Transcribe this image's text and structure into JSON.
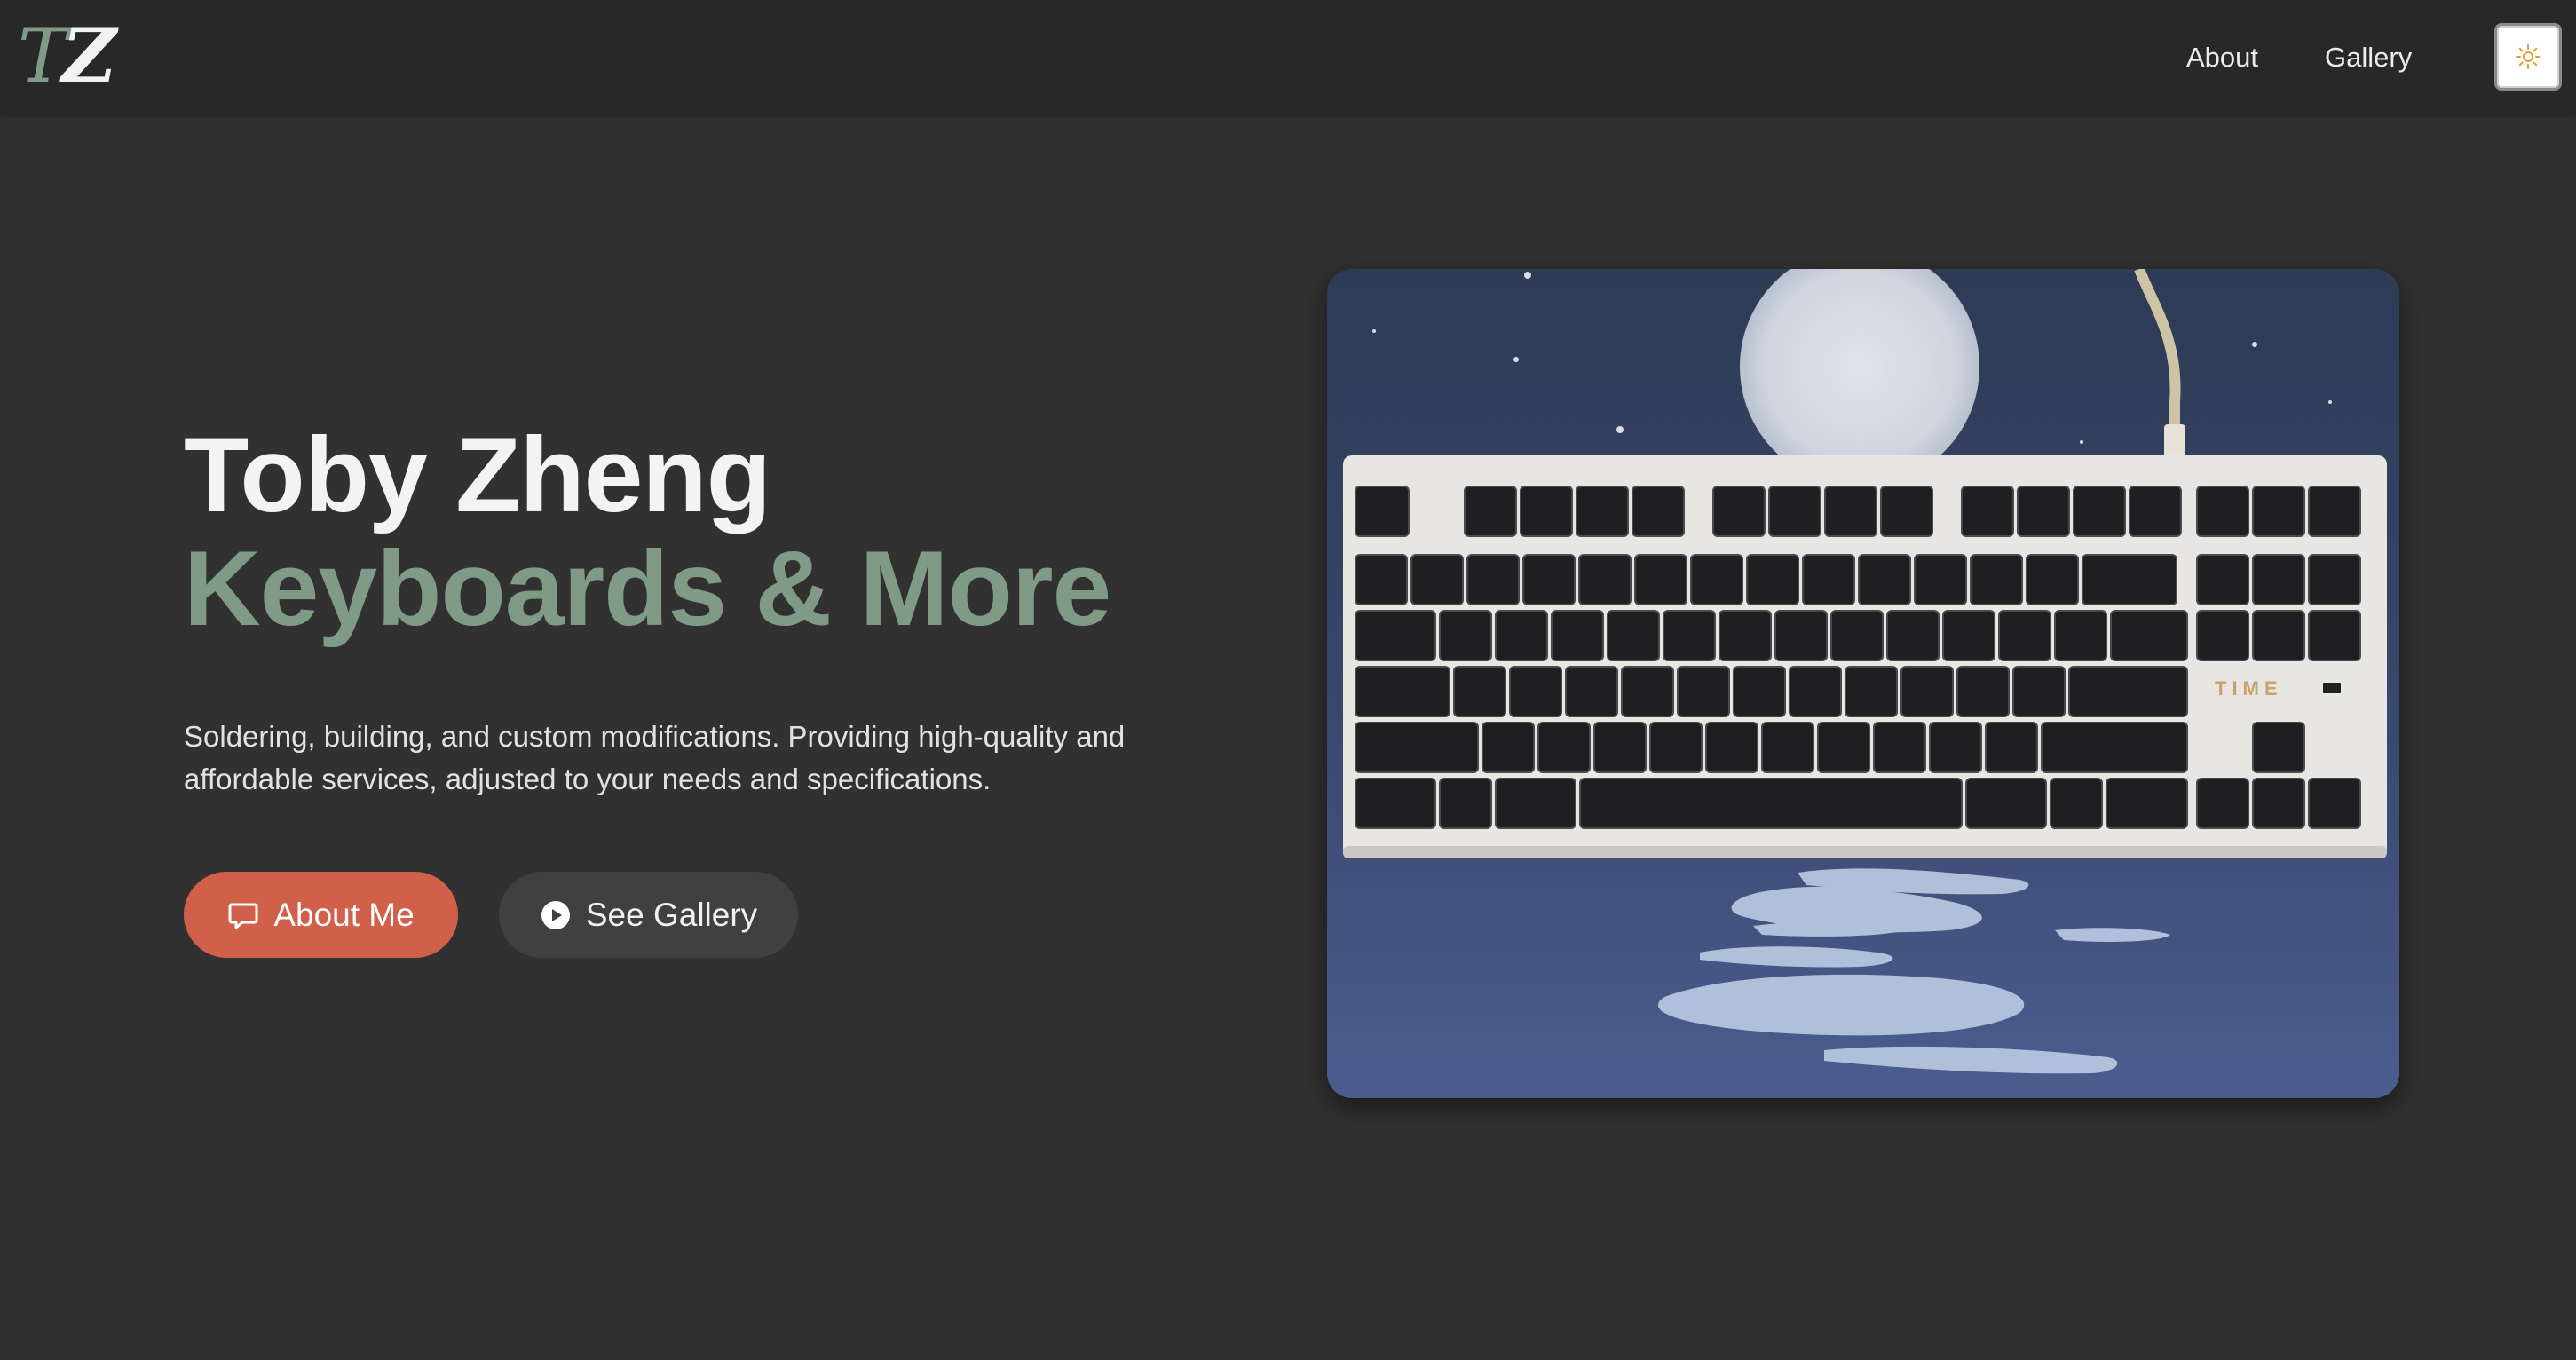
{
  "header": {
    "logo": {
      "first": "T",
      "second": "Z"
    },
    "nav": [
      {
        "label": "About"
      },
      {
        "label": "Gallery"
      }
    ],
    "theme_toggle_icon": "sun-icon"
  },
  "hero": {
    "name": "Toby Zheng",
    "tagline": "Keyboards & More",
    "description_line1": "Soldering, building, and custom modifications. Providing high-quality and",
    "description_line2": "affordable services, adjusted to your needs and specifications.",
    "buttons": {
      "primary": {
        "label": "About Me",
        "icon": "chat-bubble-icon"
      },
      "secondary": {
        "label": "See Gallery",
        "icon": "play-circle-icon"
      }
    },
    "photo": {
      "subject": "tenkeyless keyboard on a moon-themed desk mat",
      "brand_text": "TIME"
    }
  },
  "colors": {
    "background": "#313131",
    "header": "#282828",
    "accent_green": "#7f9b86",
    "primary_button": "#d1604a",
    "secondary_button": "#404040",
    "sun_icon": "#e0a030"
  }
}
